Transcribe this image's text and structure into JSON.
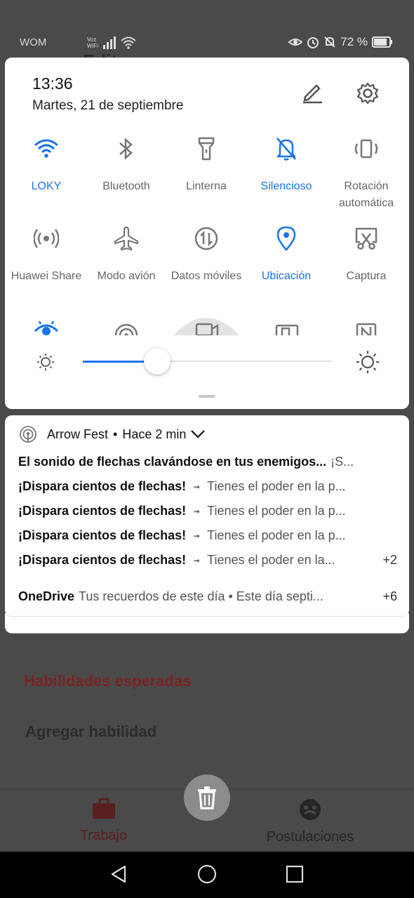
{
  "status_bar": {
    "carrier": "WOM",
    "volte": "Voz WiFi",
    "battery": "72 %"
  },
  "quick_settings": {
    "time": "13:36",
    "date": "Martes, 21 de septiembre",
    "tiles_row1": [
      {
        "label": "LOKY",
        "icon": "wifi-icon",
        "active": true
      },
      {
        "label": "Bluetooth",
        "icon": "bluetooth-icon",
        "active": false
      },
      {
        "label": "Linterna",
        "icon": "flashlight-icon",
        "active": false
      },
      {
        "label": "Silencioso",
        "icon": "bell-off-icon",
        "active": true
      },
      {
        "label": "Rotación automática",
        "icon": "rotation-icon",
        "active": false
      }
    ],
    "tiles_row2": [
      {
        "label": "Huawei Share",
        "icon": "share-icon",
        "active": false
      },
      {
        "label": "Modo avión",
        "icon": "airplane-icon",
        "active": false
      },
      {
        "label": "Datos móviles",
        "icon": "mobile-data-icon",
        "active": false
      },
      {
        "label": "Ubicación",
        "icon": "location-icon",
        "active": true
      },
      {
        "label": "Captura",
        "icon": "screenshot-icon",
        "active": false
      }
    ],
    "brightness": 0.3
  },
  "notifications": {
    "app_name": "Arrow Fest",
    "time_ago": "Hace 2 min",
    "lines": [
      {
        "title": "El sonido de flechas clavándose en tus enemigos...",
        "text": "¡S..."
      },
      {
        "title": "¡Dispara cientos de flechas!",
        "text": "Tienes el poder en la p..."
      },
      {
        "title": "¡Dispara cientos de flechas!",
        "text": "Tienes el poder en la p..."
      },
      {
        "title": "¡Dispara cientos de flechas!",
        "text": "Tienes el poder en la p..."
      },
      {
        "title": "¡Dispara cientos de flechas!",
        "text": "Tienes el poder en la...",
        "count": "+2"
      }
    ],
    "onedrive": {
      "title": "OneDrive",
      "text": "Tus recuerdos de este día • Este día septi...",
      "count": "+6"
    }
  },
  "background_app": {
    "title": "Edit",
    "skills_heading": "Habilidades esperadas",
    "add_skill": "Agregar habilidad",
    "tab_work": "Trabajo",
    "tab_applications": "Postulaciones"
  },
  "colors": {
    "accent": "#1a73e8",
    "inactive_icon": "#777777"
  }
}
